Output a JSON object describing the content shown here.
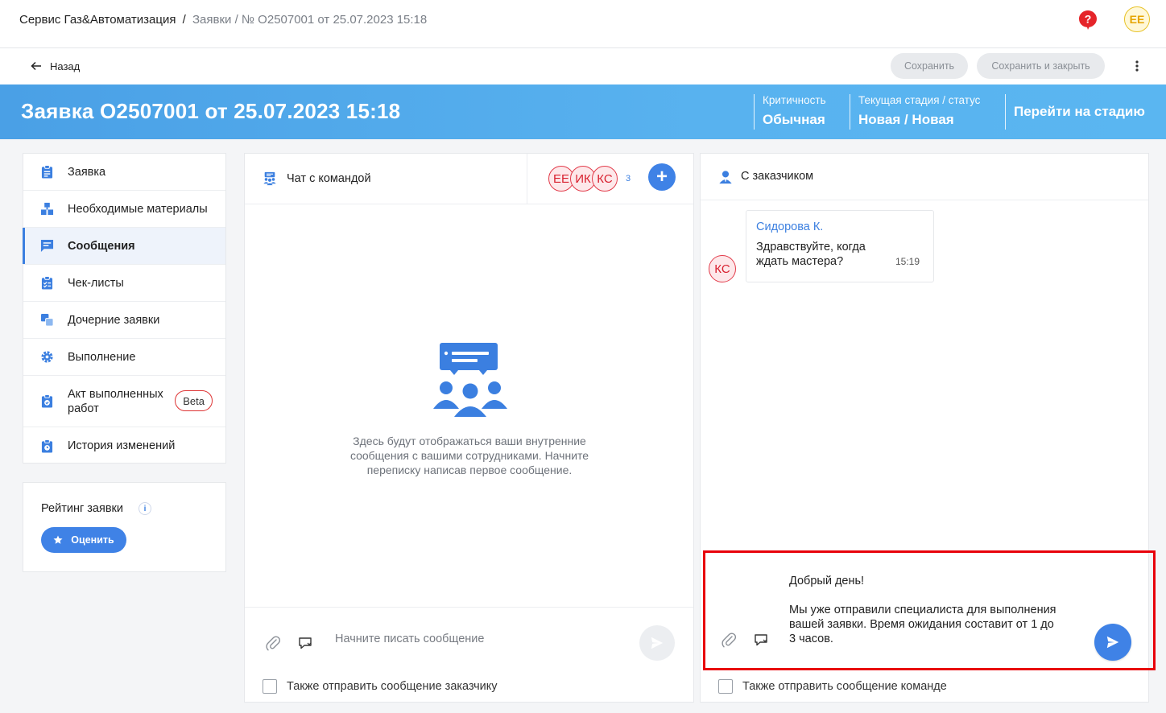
{
  "breadcrumb": {
    "root": "Сервис Газ&Автоматизация",
    "sep1": "/",
    "section": "Заявки",
    "sep2": "/",
    "current": "№ O2507001 от 25.07.2023 15:18"
  },
  "user": {
    "initials": "ЕЕ"
  },
  "icons": {
    "help": "question-circle-icon",
    "back": "arrow-left-icon",
    "more": "vertical-dots-icon"
  },
  "toolbar": {
    "back_label": "Назад",
    "save_label": "Сохранить",
    "save_close_label": "Сохранить и закрыть"
  },
  "hero": {
    "title": "Заявка O2507001 от 25.07.2023 15:18",
    "criticality_label": "Критичность",
    "criticality_value": "Обычная",
    "stage_label": "Текущая стадия / статус",
    "stage_value": "Новая / Новая",
    "goto_stage": "Перейти на стадию"
  },
  "sidebar": {
    "items": [
      {
        "label": "Заявка",
        "icon": "clipboard-icon"
      },
      {
        "label": "Необходимые материалы",
        "icon": "boxes-icon"
      },
      {
        "label": "Сообщения",
        "icon": "message-icon",
        "active": true
      },
      {
        "label": "Чек-листы",
        "icon": "checklist-icon"
      },
      {
        "label": "Дочерние заявки",
        "icon": "copy-icon"
      },
      {
        "label": "Выполнение",
        "icon": "gear-icon"
      },
      {
        "label": "Акт выполненных работ",
        "icon": "document-check-icon",
        "badge": "Beta"
      },
      {
        "label": "История изменений",
        "icon": "history-icon"
      }
    ]
  },
  "rating": {
    "title": "Рейтинг заявки",
    "info": "i",
    "button_label": "Оценить"
  },
  "team_chat": {
    "title": "Чат с командой",
    "members": [
      "ЕЕ",
      "ИК",
      "КС"
    ],
    "member_count": "3",
    "add": "+",
    "empty_text": "Здесь будут отображаться ваши внутренние сообщения с вашими сотрудниками. Начните переписку написав первое сообщение.",
    "input_placeholder": "Начните писать сообщение",
    "also_send_label": "Также отправить сообщение заказчику"
  },
  "customer_chat": {
    "title": "С заказчиком",
    "messages": [
      {
        "avatar": "КС",
        "author": "Сидорова К.",
        "text": "Здравствуйте, когда ждать мастера?",
        "time": "15:19"
      }
    ],
    "draft": "Добрый день!\n\nМы уже отправили специалиста для выполнения вашей заявки. Время ожидания составит от 1 до 3 часов.",
    "also_send_label": "Также отправить сообщение команде"
  },
  "colors": {
    "accent": "#3f82e6",
    "hero_start": "#4aa0e6",
    "hero_end": "#5ab6f1",
    "avatar_red": "#e23b4a",
    "highlight": "#e8000a"
  }
}
